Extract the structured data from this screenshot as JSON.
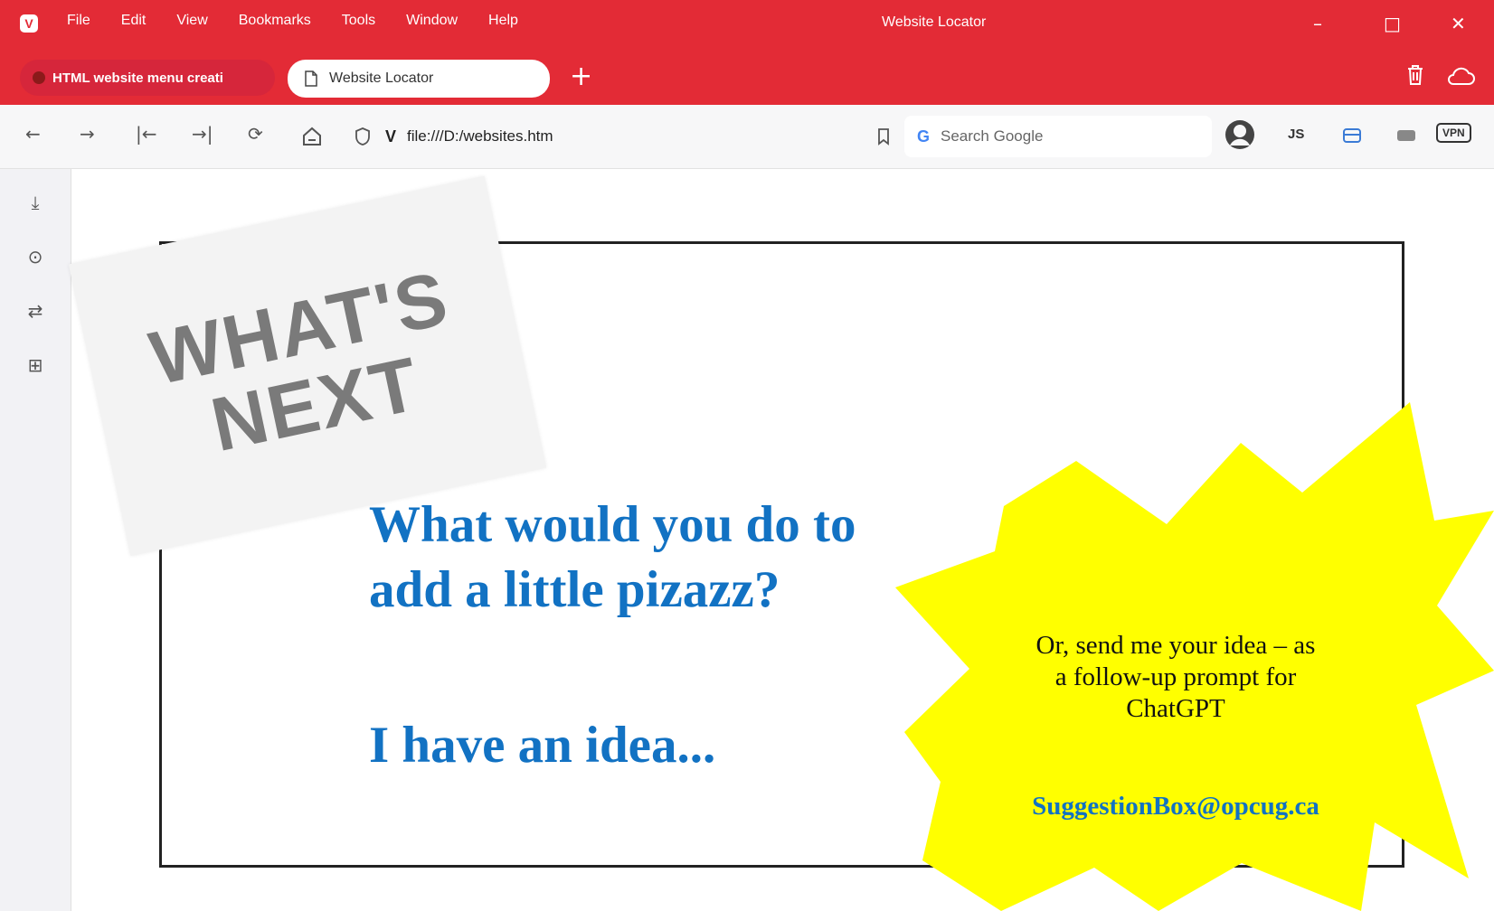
{
  "window": {
    "app_logo": "V",
    "title": "Website Locator",
    "menu": [
      "File",
      "Edit",
      "View",
      "Bookmarks",
      "Tools",
      "Window",
      "Help"
    ],
    "minimize": "–",
    "maximize": "□",
    "close": "✕"
  },
  "tabs": [
    {
      "label": "HTML website menu creati"
    },
    {
      "label": "Website Locator"
    }
  ],
  "new_tab": "+",
  "toolbar": {
    "url_prefix": "V",
    "url": "file:///D:/websites.htm",
    "search_placeholder": "Search Google",
    "search_g": "G",
    "js_label": "JS",
    "vpn_label": "VPN"
  },
  "page": {
    "sticker_lines": [
      "WHAT'S",
      "NEXT"
    ],
    "heading_lines": [
      "What would you do to",
      "add a little pizazz?"
    ],
    "heading2": "I have an idea...",
    "burst_lines": [
      "Or, send me your idea – as",
      "a follow-up prompt for",
      "ChatGPT"
    ],
    "email": "SuggestionBox@opcug.ca"
  },
  "colors": {
    "brand_red": "#e32b36",
    "heading_blue": "#1272c3",
    "burst_yellow": "#ffff00"
  }
}
